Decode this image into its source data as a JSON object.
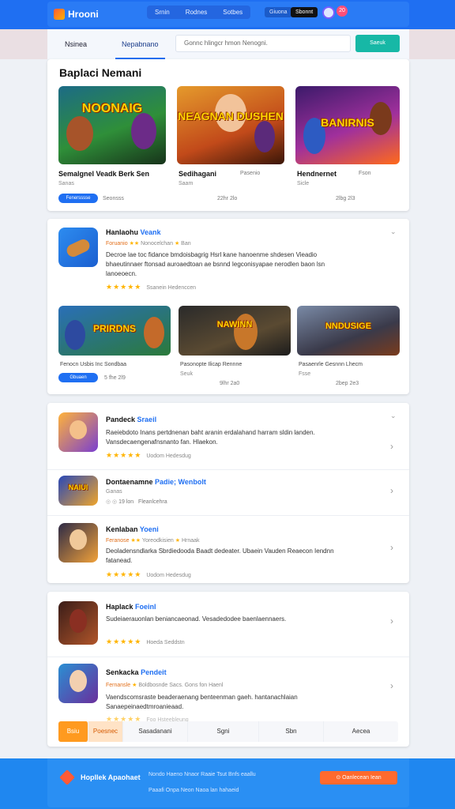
{
  "header": {
    "brand": "Hrooni",
    "nav": [
      "Srnin",
      "Rodnes",
      "Sotbes"
    ],
    "btn_secondary": "Giuona",
    "btn_primary": "Sbonnt",
    "badge": "20"
  },
  "subheader": {
    "tabs": [
      "Nsinea",
      "Nepabnano"
    ],
    "search_placeholder": "Gonnc hlingcr hmon Nenogni.",
    "search_button": "Saeuk"
  },
  "featured": {
    "title": "Baplaci Nemani",
    "games": [
      {
        "thumb_text": "NOONAIG",
        "title": "Semalgnel Veadk Berk Sen",
        "sub": "Sanas",
        "pill": "Fenersssse",
        "meta_left": "Seonsss",
        "meta": "",
        "accent": "#2c6a3a"
      },
      {
        "thumb_text": "NEAGNAN DUSHEN",
        "title": "Sedihagani",
        "sub": "Saam",
        "meta_mid": "Pasenio",
        "meta": "22hr 2lo",
        "accent": "#c4561c"
      },
      {
        "thumb_text": "BANIRNIS",
        "title": "Hendnernet",
        "sub": "Sicle",
        "meta_mid": "Fson",
        "meta": "2lbg 2l3",
        "accent": "#6a2f9c"
      }
    ]
  },
  "app_card1": {
    "title": "Hanlaohu",
    "tag": "Veank",
    "meta_orange": "Foruanio",
    "meta_gray": "Nonocelchan",
    "meta_extra": "Ban",
    "desc": "Decroe lae toc fidance bmdoisbagrig Hsrl kane hanoenme shdesen Vieadio bhaeutinnaer ftonsad auroaedtoan ae bsnnd Iegconisyapae nerodlen baon lsn lanoeoecn.",
    "stars": "★★★★★",
    "stars_label": "Ssanein Hedenccen",
    "games": [
      {
        "thumb_text": "PRIRDNS",
        "title": "Fenocn Usbis Inc Sondbaa",
        "pill": "Gbuaen",
        "meta": "5 fhe 2l9",
        "accent": "#2d5fa0"
      },
      {
        "thumb_text": "NAWINN",
        "title": "Pasonopte Ilicap Rennne",
        "sub": "Seuk",
        "meta": "9lhr 2a0",
        "accent": "#3e3a30"
      },
      {
        "thumb_text": "NNDUSIGE",
        "title": "Pasaenrle Gesnnn Lhecm",
        "sub": "Fsse",
        "meta": "2bep 2e3",
        "accent": "#7a3b1c"
      }
    ]
  },
  "list": [
    {
      "title": "Pandeck",
      "tag": "Sraeil",
      "desc": "Raeiebdoto Inans pertdnenan baht aranin erdalahand harram sldin landen. Vansdecaengenafnsnanto fan. Hlaekon.",
      "stars": "★★★★★",
      "stars_label": "Uodom Hedesdug",
      "chev": "›",
      "accent": "#ff9d2a"
    },
    {
      "title": "Dontaenamne",
      "tag": "Padie; Wenbolt",
      "sub": "Ganas",
      "meta": "19 lon",
      "meta2": "Fleanlcehra",
      "chev": "›",
      "accent": "#2747b8"
    },
    {
      "title": "Kenlaban",
      "tag": "Yoeni",
      "meta_orange": "Feranose",
      "meta_gray": "Yoreodkisien",
      "meta_extra": "Hrnaak",
      "desc": "Deoladensndlarka Sbrdiedooda Baadt dedeater. Ubaein Vauden Reaecon Iendnn fatanead.",
      "stars": "★★★★★",
      "stars_label": "Uodom Hedesdug",
      "chev": "›",
      "accent": "#f2a23a"
    },
    {
      "title": "Haplack",
      "tag": "Foeinl",
      "desc": "Sudeiaerauonlan beniancaeonad. Vesadedodee baenlaennaers.",
      "stars": "★★★★★",
      "stars_label": "Hoeda Seddstn",
      "chev": "›",
      "accent": "#6b2f2a"
    },
    {
      "title": "Senkacka",
      "tag": "Pendeit",
      "meta_orange": "Fernansle",
      "meta_gray": "Boldbosnde",
      "meta_extra": "Sacs. Gons fon Haenl",
      "desc": "Vaendscomsraste beaderaenang benteenman gaeh. hantanachlaian Sanaepeinaedtmroanieaad.",
      "stars": "★★★★★",
      "stars_label": "Foo Hsteebleung",
      "chev": "›",
      "accent": "#2a8fd3"
    }
  ],
  "pager": {
    "items": [
      "Bsiu",
      "Poesnec",
      "Sasadanani",
      "Sgni",
      "Sbn",
      "Aecea"
    ]
  },
  "footer": {
    "brand": "Hopllek Apaohaet",
    "links1": "Nondo Haeno Nnaor Raaie  Tsut Bnfs eaallu",
    "links2": "Paaafi Onpa Neon Naoa lan hahaeid",
    "cta": "⊙ Oanlecean Iean"
  },
  "colors": {
    "primary": "#1f6ff2",
    "teal": "#17b8a6",
    "orange": "#ff9a1f",
    "star": "#ffb400"
  }
}
